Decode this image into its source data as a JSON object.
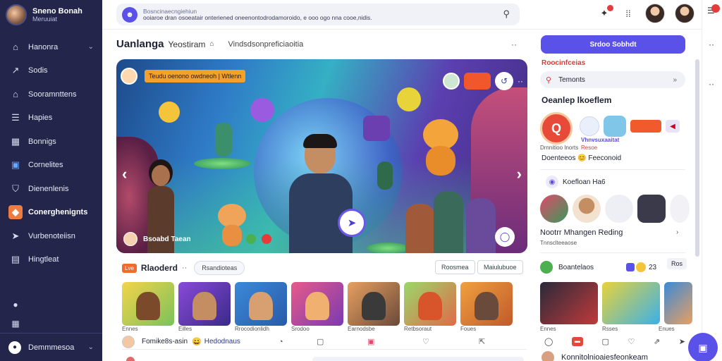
{
  "brand": {
    "name": "Sneno Bonah",
    "subtitle": "Meruuiat"
  },
  "sidebar": {
    "items": [
      {
        "label": "Hanonra",
        "icon": "home-icon",
        "chevron": "⌄"
      },
      {
        "label": "Sodis",
        "icon": "trending-icon"
      },
      {
        "label": "Sooramnttens",
        "icon": "briefcase-icon"
      },
      {
        "label": "Hapies",
        "icon": "list-icon"
      },
      {
        "label": "Bonnigs",
        "icon": "grid-icon"
      },
      {
        "label": "Cornelites",
        "icon": "calendar-icon"
      },
      {
        "label": "Dienenlenis",
        "icon": "shield-icon"
      },
      {
        "label": "Conerghenignts",
        "icon": "gamepad-icon",
        "active": true
      },
      {
        "label": "Vurbenoteiisn",
        "icon": "send-icon"
      },
      {
        "label": "Hingtleat",
        "icon": "document-icon"
      }
    ],
    "bottom": {
      "label": "Demmmesoa",
      "chevron": "⌄"
    }
  },
  "search": {
    "line1": "Bosncinaecngiehiun",
    "line2": "ooiaroe dran osoeatair onteriened oneenontodrodamoroido, e ooo ogo nna cooe,nidis."
  },
  "main": {
    "title": "Uanlanga",
    "title2": "Yeostiram",
    "subtitle": "Vindsdsonpreficiaoitia",
    "more": "··"
  },
  "hero": {
    "badge_label": "Teudu oenono owdneoh | Wtlenn",
    "footer_name": "Bsoabd Taean"
  },
  "section": {
    "tag": "Lve",
    "label": "Rlaoderd",
    "dots": "··",
    "chip": "Rsandioteas",
    "pill1": "Roosmea",
    "pill2": "Maiulubuoe"
  },
  "thumb_captions": [
    "Ennes",
    "Eilles",
    "Rrocodionlidh",
    "Srodoo",
    "Earnodsbe",
    "Retbsoraut",
    "Foues"
  ],
  "feed_row": {
    "name": "Fomike8s-asin",
    "emoji": "😄",
    "name2": "Hedodnaus"
  },
  "right": {
    "primary_button": "Srdoo Sobhdt",
    "red_heading": "Roocinfceias",
    "search_value": "Temonts",
    "heading": "Oeanlep lkoeflem",
    "logo_letter": "Q",
    "small1": "Drnnitioo Inorts",
    "small2": "Vhnvsuxaaitat",
    "small3": "Resoe",
    "line1": "Doenteeos 😊 Feeconoid",
    "chat": "Koefloan Ha6",
    "heading2": "Nootrr Mhangen Reding",
    "heading2_sub": "Tnnsclteeaose",
    "more": "›",
    "podcast": "Boantelaos",
    "podcast_num": "23",
    "podcast_btn": "Ros",
    "thumb_caps": [
      "Ennes",
      "Rsses",
      "Enues"
    ],
    "footer": "Konnitolnioaiesfeonkeam"
  }
}
